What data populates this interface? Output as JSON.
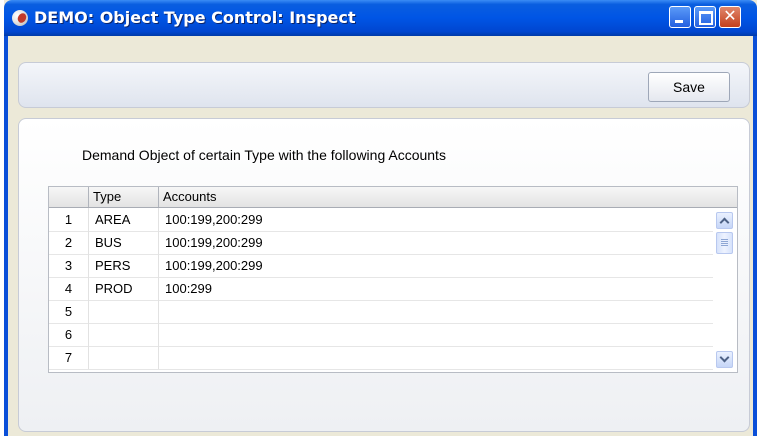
{
  "window": {
    "title": "DEMO: Object Type Control: Inspect",
    "close_glyph": "✕",
    "controls": [
      "minimize-icon",
      "maximize-icon",
      "close-icon"
    ]
  },
  "toolbar": {
    "save_label": "Save"
  },
  "main": {
    "heading": "Demand Object of certain Type with the following Accounts",
    "table": {
      "columns": [
        "",
        "Type",
        "Accounts"
      ],
      "rows": [
        {
          "num": "1",
          "type": "AREA",
          "accounts": "100:199,200:299"
        },
        {
          "num": "2",
          "type": "BUS",
          "accounts": "100:199,200:299"
        },
        {
          "num": "3",
          "type": "PERS",
          "accounts": "100:199,200:299"
        },
        {
          "num": "4",
          "type": "PROD",
          "accounts": "100:299"
        },
        {
          "num": "5",
          "type": "",
          "accounts": ""
        },
        {
          "num": "6",
          "type": "",
          "accounts": ""
        },
        {
          "num": "7",
          "type": "",
          "accounts": ""
        }
      ]
    }
  },
  "colors": {
    "titlebar": "#0055e5",
    "window_bg": "#ece9d8",
    "close_button": "#c4401c"
  }
}
